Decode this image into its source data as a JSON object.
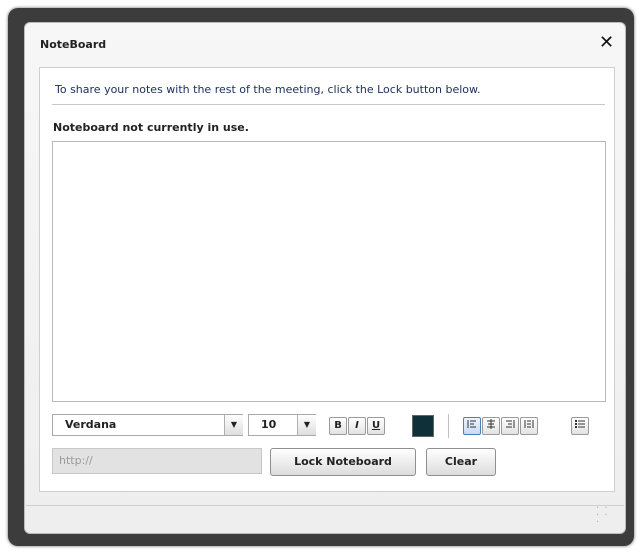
{
  "dialog": {
    "title": "NoteBoard",
    "close_icon": "close-icon"
  },
  "content": {
    "instructions": "To share your notes with the rest of the meeting, click the Lock button below.",
    "status": "Noteboard not currently in use."
  },
  "toolbar": {
    "font_family": "Verdana",
    "font_size": "10",
    "bold_label": "B",
    "italic_label": "I",
    "underline_label": "U",
    "text_color": "#0f3038"
  },
  "link": {
    "placeholder": "http://"
  },
  "buttons": {
    "lock_label": "Lock Noteboard",
    "clear_label": "Clear"
  }
}
